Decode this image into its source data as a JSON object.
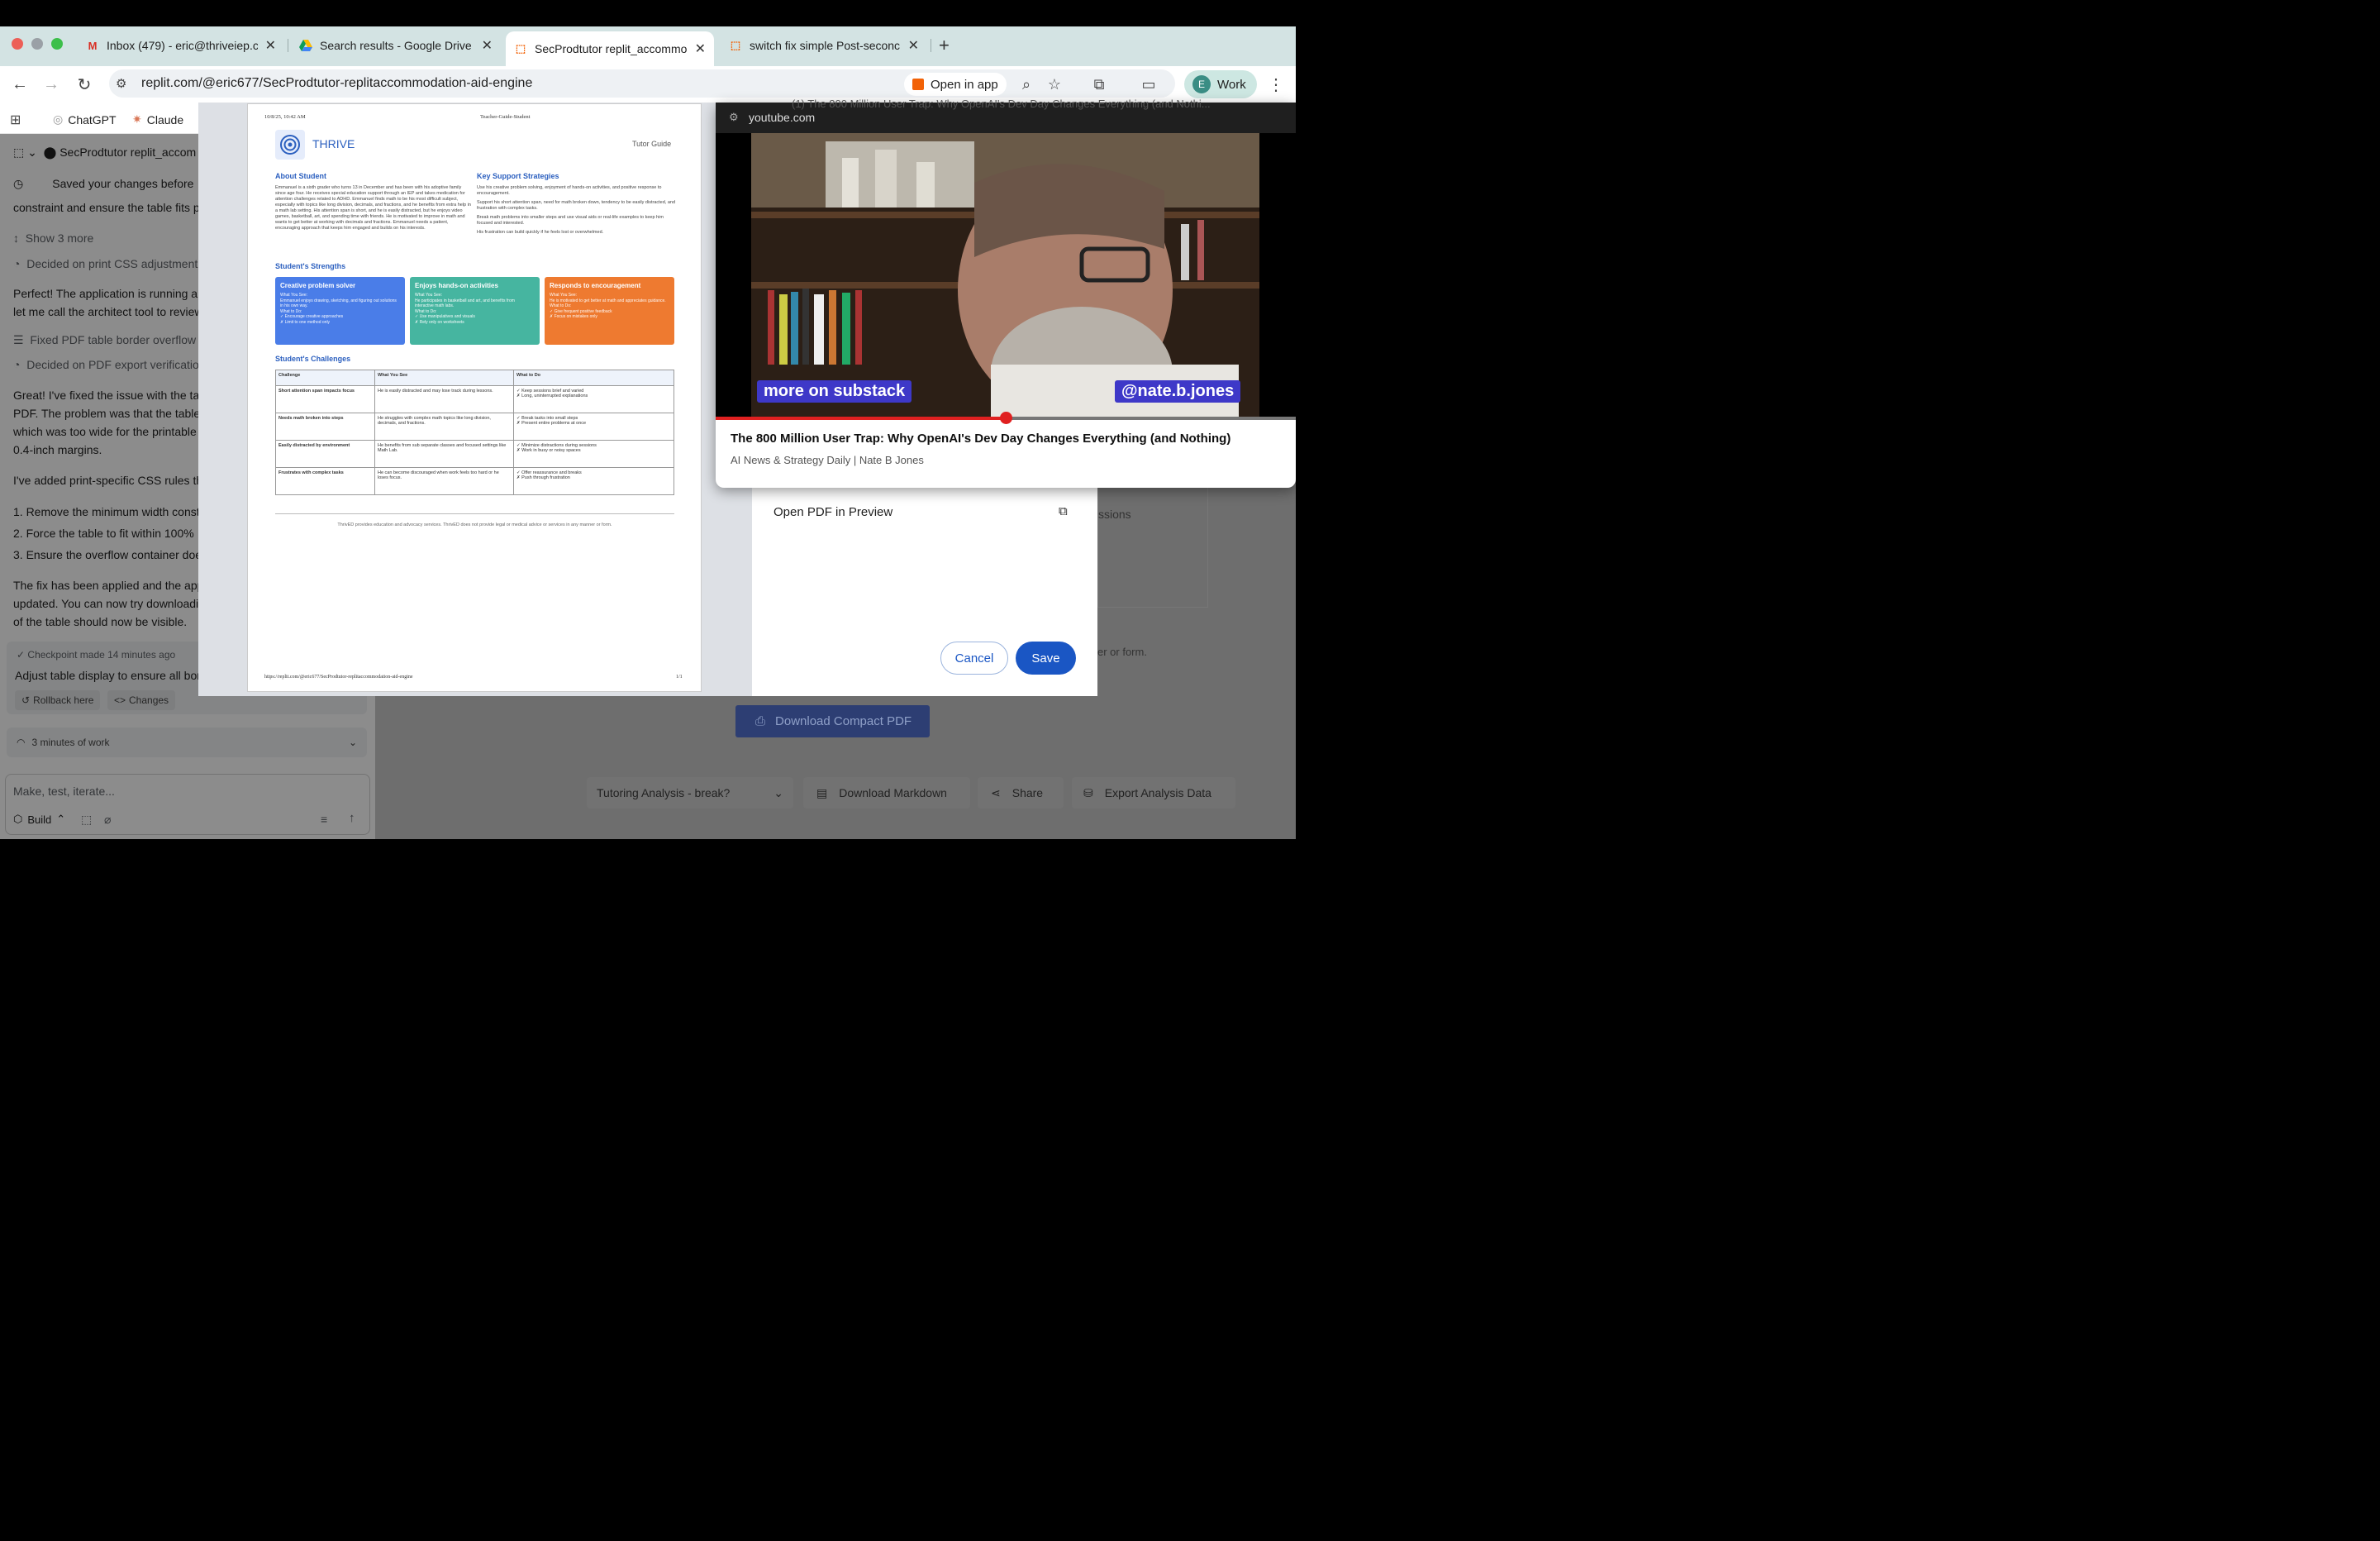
{
  "tabs": [
    {
      "title": "Inbox (479) - eric@thriveiep.c",
      "icon": "gmail-icon"
    },
    {
      "title": "Search results - Google Drive",
      "icon": "drive-icon"
    },
    {
      "title": "SecProdtutor replit_accommo",
      "icon": "replit-icon"
    },
    {
      "title": "switch fix simple Post-seconc",
      "icon": "replit-icon"
    }
  ],
  "toolbar": {
    "url": "replit.com/@eric677/SecProdtutor-replitaccommodation-aid-engine",
    "open_in_app": "Open in app",
    "profile": "Work",
    "profile_initial": "E"
  },
  "bookmarks": [
    "ChatGPT",
    "Claude"
  ],
  "left": {
    "project": "SecProdtutor replit_accom",
    "saved": "Saved your changes before",
    "line1": "constraint and ensure the table fits p",
    "show_more": "Show 3 more",
    "decided_print": "Decided on print CSS adjustment",
    "p1a": "Perfect! The application is running ar",
    "p1b": "let me call the architect tool to review",
    "fixed": "Fixed PDF table border overflow i",
    "decided_pdf": "Decided on PDF export verificatio",
    "p2a": "Great! I've fixed the issue with the ta",
    "p2b": "PDF. The problem was that the table",
    "p2c": "which was too wide for the printable",
    "p2d": "0.4-inch margins.",
    "p3": "I've added print-specific CSS rules th",
    "li1": "1. Remove the minimum width const",
    "li2": "2. Force the table to fit within 100%",
    "li3": "3. Ensure the overflow container doe",
    "p4a": "The fix has been applied and the app",
    "p4b": "updated. You can now try downloadi",
    "p4c": "of the table should now be visible.",
    "checkpoint": "Checkpoint made 14 minutes ago",
    "checkpoint_desc": "Adjust table display to ensure all bor",
    "rollback": "Rollback here",
    "changes": "Changes",
    "work": "3 minutes of work",
    "input_placeholder": "Make, test, iterate...",
    "build": "Build"
  },
  "pdf": {
    "date": "10/8/25, 10:42 AM",
    "header_title": "Teacher-Guide-Student",
    "brand": "THRIVE",
    "guide": "Tutor Guide",
    "about_h": "About Student",
    "about": "Emmanuel is a sixth grader who turns 13 in December and has been with his adoptive family since age four. He receives special education support through an IEP and takes medication for attention challenges related to ADHD. Emmanuel finds math to be his most difficult subject, especially with topics like long division, decimals, and fractions, and he benefits from extra help in a math lab setting. His attention span is short, and he is easily distracted, but he enjoys video games, basketball, art, and spending time with friends. He is motivated to improve in math and wants to get better at working with decimals and fractions. Emmanuel needs a patient, encouraging approach that keeps him engaged and builds on his interests.",
    "strat_h": "Key Support Strategies",
    "strat": [
      "Use his creative problem solving, enjoyment of hands-on activities, and positive response to encouragement.",
      "Support his short attention span, need for math broken down, tendency to be easily distracted, and frustration with complex tasks.",
      "Break math problems into smaller steps and use visual aids or real-life examples to keep him focused and interested.",
      "His frustration can build quickly if he feels lost or overwhelmed."
    ],
    "strengths_h": "Student's Strengths",
    "cards": [
      {
        "title": "Creative problem solver",
        "see_h": "What You See:",
        "see": "Emmanuel enjoys drawing, sketching, and figuring out solutions in his own way.",
        "do_h": "What to Do:",
        "do1": "✓ Encourage creative approaches",
        "do2": "✗ Limit to one method only",
        "color": "#4a7de8"
      },
      {
        "title": "Enjoys hands-on activities",
        "see_h": "What You See:",
        "see": "He participates in basketball and art, and benefits from interactive math labs.",
        "do_h": "What to Do:",
        "do1": "✓ Use manipulatives and visuals",
        "do2": "✗ Rely only on worksheets",
        "color": "#46b5a0"
      },
      {
        "title": "Responds to encouragement",
        "see_h": "What You See:",
        "see": "He is motivated to get better at math and appreciates guidance.",
        "do_h": "What to Do:",
        "do1": "✓ Give frequent positive feedback",
        "do2": "✗ Focus on mistakes only",
        "color": "#ee7a30"
      }
    ],
    "challenges_h": "Student's Challenges",
    "table_headers": [
      "Challenge",
      "What You See",
      "What to Do"
    ],
    "rows": [
      [
        "Short attention span impacts focus",
        "He is easily distracted and may lose track during lessons.",
        "✓ Keep sessions brief and varied",
        "✗ Long, uninterrupted explanations"
      ],
      [
        "Needs math broken into steps",
        "He struggles with complex math topics like long division, decimals, and fractions.",
        "✓ Break tasks into small steps",
        "✗ Present entire problems at once"
      ],
      [
        "Easily distracted by environment",
        "He benefits from sub separate classes and focused settings like Math Lab.",
        "✓ Minimize distractions during sessions",
        "✗ Work in busy or noisy spaces"
      ],
      [
        "Frustrates with complex tasks",
        "He can become discouraged when work feels too hard or he loses focus.",
        "✓ Offer reassurance and breaks",
        "✗ Push through frustration"
      ]
    ],
    "disclaimer": "ThrivED provides education and advocacy services. ThrivED does not provide legal or medical advice or services in any manner or form.",
    "footer_url": "https://replit.com/@eric677/SecProdtutor-replitaccommodation-aid-engine",
    "page": "1/1"
  },
  "dialog": {
    "open_preview": "Open PDF in Preview",
    "cancel": "Cancel",
    "save": "Save"
  },
  "pip": {
    "domain": "youtube.com",
    "header_title": "(1) The 800 Million User Trap: Why OpenAI's Dev Day Changes Everything (and Nothi...",
    "overlay_left": "more on substack",
    "overlay_right": "@nate.b.jones",
    "title": "The 800 Million User Trap: Why OpenAI's Dev Day Changes Everything (and Nothing)",
    "channel": "AI News & Strategy Daily | Nate B Jones",
    "progress": 0.5
  },
  "behind": {
    "sessions": "ssions",
    "form": "er or form.",
    "compact_pdf": "Download Compact PDF",
    "tutoring": "Tutoring Analysis - break?",
    "markdown": "Download Markdown",
    "share": "Share",
    "export": "Export Analysis Data"
  }
}
